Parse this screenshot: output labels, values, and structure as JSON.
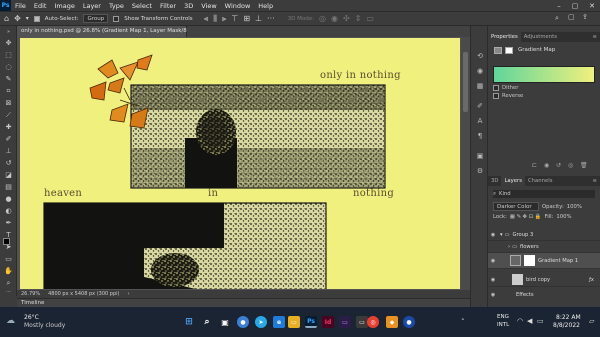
{
  "app": {
    "logo": "Ps"
  },
  "menu": [
    "File",
    "Edit",
    "Image",
    "Layer",
    "Type",
    "Select",
    "Filter",
    "3D",
    "View",
    "Window",
    "Help"
  ],
  "options_bar": {
    "auto_select_label": "Auto-Select:",
    "auto_select_value": "Group",
    "show_transform_label": "Show Transform Controls",
    "mode_3d_label": "3D Mode:"
  },
  "document": {
    "tab_title": "only in nothing.psd @ 26.8% (Gradient Map 1, Layer Mask/8) *",
    "close_glyph": "×"
  },
  "canvas_text": {
    "top_right": "only in nothing",
    "word1": "heaven",
    "word2": "in",
    "word3": "nothing"
  },
  "status": {
    "zoom": "26.79%",
    "dimensions": "4800 px x 5408 px (300 ppi)"
  },
  "timeline": {
    "label": "Timeline"
  },
  "properties": {
    "tab_active": "Properties",
    "tab_other": "Adjustments",
    "title": "Gradient Map",
    "dither_label": "Dither",
    "reverse_label": "Reverse",
    "gradient_colors": [
      "#5fd69a",
      "#f0f07e"
    ]
  },
  "layers_panel": {
    "tabs": [
      "3D",
      "Layers",
      "Channels"
    ],
    "kind_label": "Kind",
    "blend_mode": "Darker Color",
    "opacity_label": "Opacity:",
    "opacity_value": "100%",
    "lock_label": "Lock:",
    "fill_label": "Fill:",
    "fill_value": "100%",
    "rows": [
      {
        "name": "Group 3"
      },
      {
        "name": "flowers"
      },
      {
        "name": "Gradient Map 1"
      },
      {
        "name": "bird copy"
      },
      {
        "name": "Effects"
      }
    ]
  },
  "taskbar": {
    "weather_temp": "26°C",
    "weather_desc": "Mostly cloudy",
    "lang1": "ENG",
    "lang2": "INTL",
    "time": "8:22 AM",
    "date": "8/8/2022"
  },
  "icons": {
    "search": "search-icon",
    "windows": "windows-icon"
  }
}
